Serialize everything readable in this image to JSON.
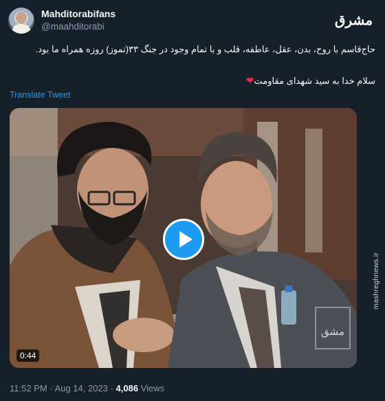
{
  "author": {
    "display_name": "Mahditorabifans",
    "handle": "@maahditorabi"
  },
  "source_logo": "مشرق",
  "tweet": {
    "line1": "حاج‌قاسم با روح، بدن، عقل، عاطفه، قلب و با تمام وجود در جنگ ۳۳(تموز) روزه همراه ما بود.",
    "line2": "سلام خدا به سید شهدای مقاومت",
    "heart_icon": "red-heart-icon",
    "translate_label": "Translate Tweet"
  },
  "video": {
    "duration": "0:44",
    "play_icon": "play-icon"
  },
  "side_watermark": "mashreghnews.ir",
  "meta": {
    "time": "11:52 PM",
    "separator": "·",
    "date": "Aug 14, 2023",
    "views_count": "4,086",
    "views_label": "Views"
  },
  "colors": {
    "background": "#15202b",
    "link": "#1d9bf0",
    "secondary_text": "#8b98a5"
  }
}
